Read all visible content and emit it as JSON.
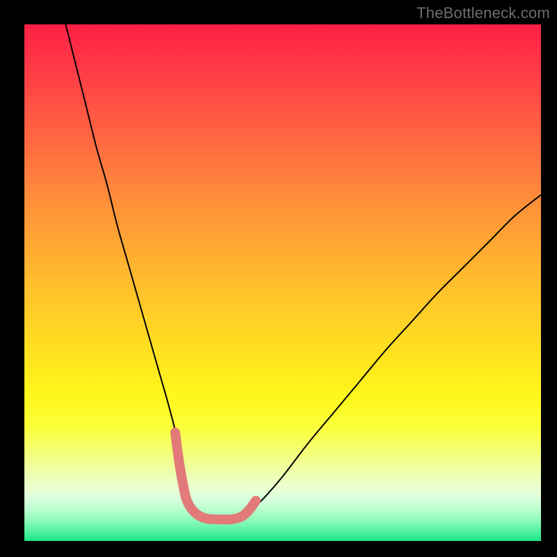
{
  "watermark": "TheBottleneck.com",
  "chart_data": {
    "type": "line",
    "title": "",
    "xlabel": "",
    "ylabel": "",
    "xlim": [
      0,
      100
    ],
    "ylim": [
      0,
      100
    ],
    "grid": false,
    "legend": false,
    "series": [
      {
        "name": "black-curve",
        "color": "#000000",
        "stroke_width": 2,
        "x": [
          8,
          10,
          12,
          14,
          16,
          18,
          20,
          22,
          24,
          26,
          28,
          29.5,
          30.5,
          31.5,
          33,
          35,
          37.5,
          40,
          42,
          44,
          47,
          50,
          55,
          60,
          65,
          70,
          75,
          80,
          85,
          90,
          95,
          100
        ],
        "y": [
          100,
          92,
          84,
          76,
          69,
          61,
          54,
          47,
          40,
          33,
          26,
          20,
          14,
          9,
          5.5,
          4.4,
          4.2,
          4.2,
          4.6,
          6.0,
          9.0,
          12.5,
          19,
          25,
          31,
          37,
          42.5,
          48,
          53,
          58,
          63,
          67
        ]
      },
      {
        "name": "pink-segment",
        "color": "#e17a79",
        "stroke_width": 14,
        "linecap": "round",
        "x": [
          29.2,
          30.0,
          30.9,
          31.6,
          33.0,
          35.0,
          37.5,
          40.0,
          42.0,
          43.5,
          44.8
        ],
        "y": [
          21.0,
          15.0,
          10.0,
          7.5,
          5.5,
          4.4,
          4.2,
          4.2,
          4.7,
          6.0,
          7.8
        ]
      }
    ],
    "annotations": []
  },
  "colors": {
    "page_background": "#000000",
    "gradient_top": "#ff1f45",
    "gradient_bottom": "#1be686",
    "watermark": "#6d6d6d",
    "curve_black": "#000000",
    "curve_pink": "#e17a79"
  }
}
